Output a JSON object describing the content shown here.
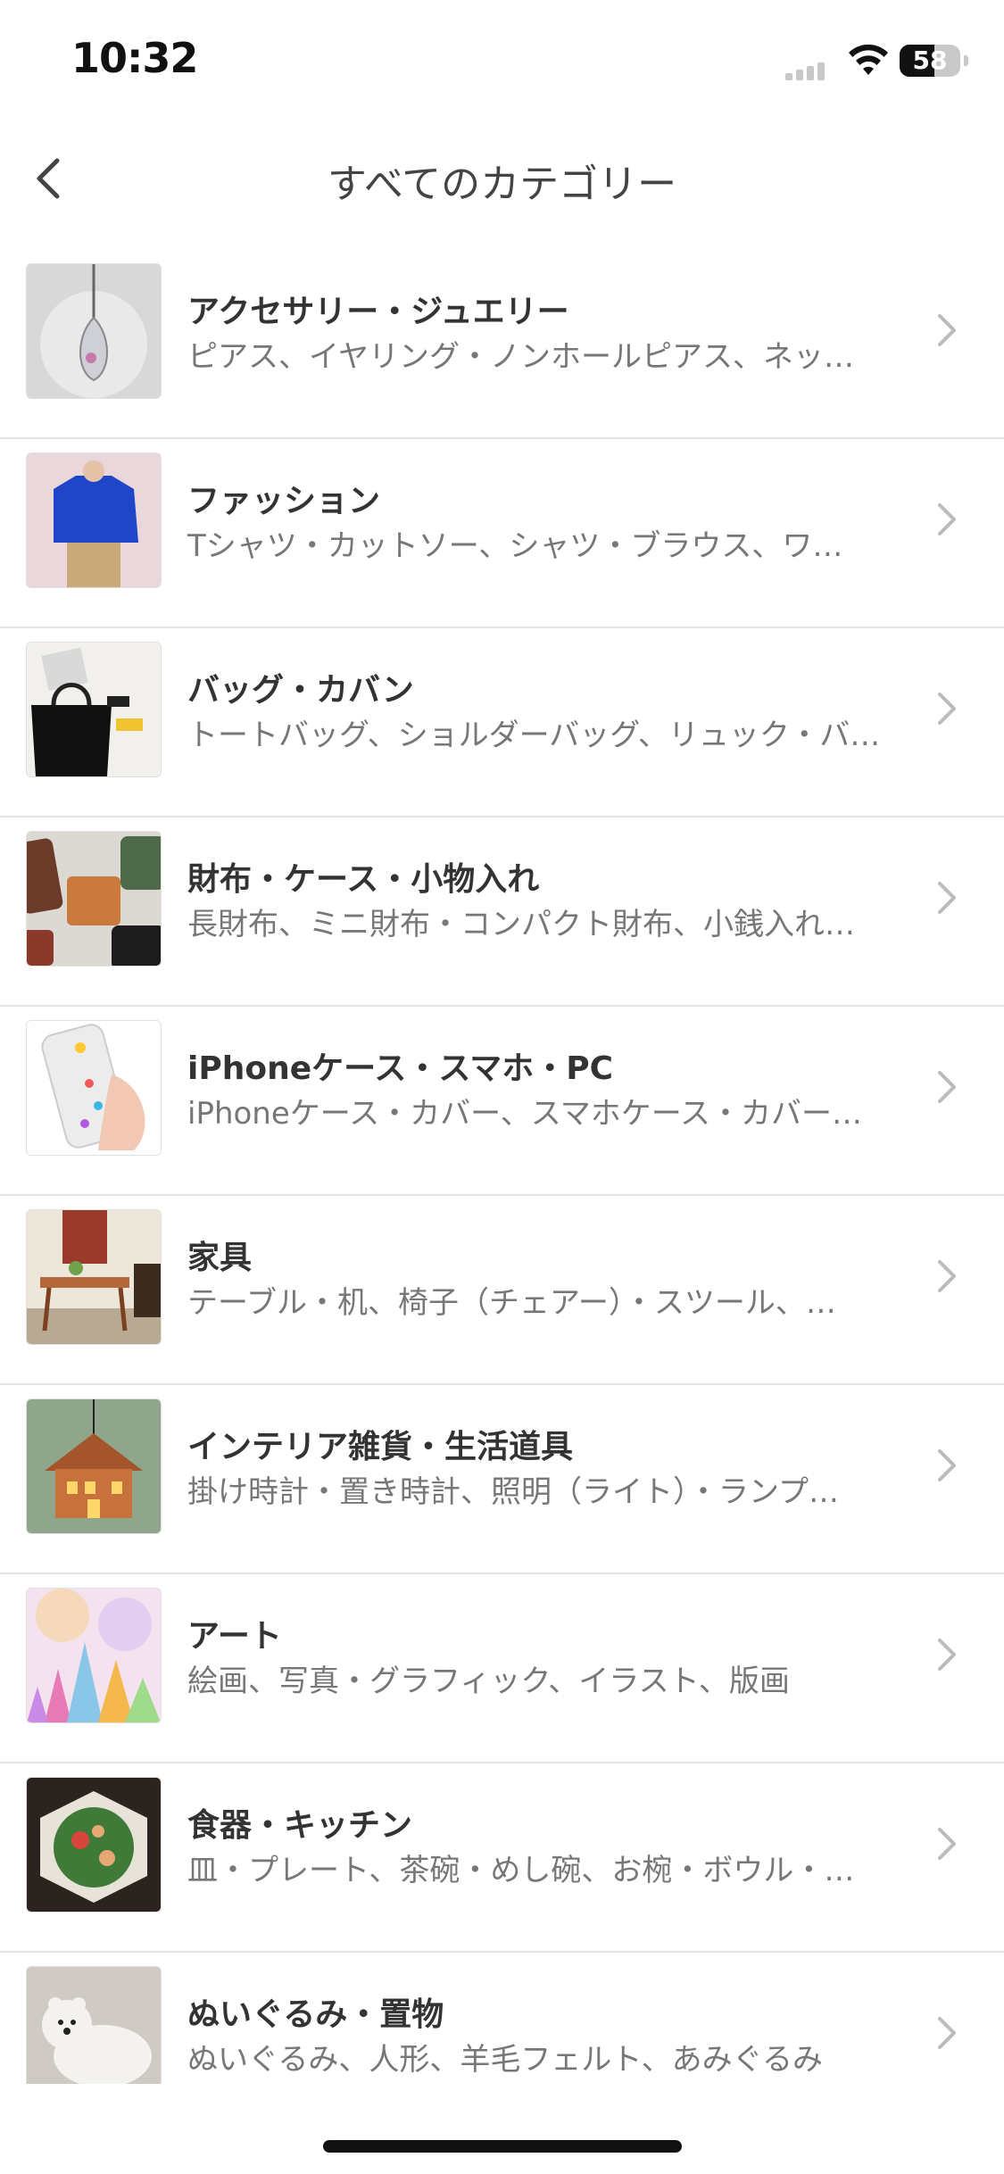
{
  "status": {
    "time": "10:32",
    "battery": "58",
    "battery_level": 0.58
  },
  "nav": {
    "title": "すべてのカテゴリー"
  },
  "categories": [
    {
      "title": "アクセサリー・ジュエリー",
      "subtitle": "ピアス、イヤリング・ノンホールピアス、ネッ…",
      "thumb": "necklace-pendant"
    },
    {
      "title": "ファッション",
      "subtitle": "Tシャツ・カットソー、シャツ・ブラウス、ワ…",
      "thumb": "blue-blouse"
    },
    {
      "title": "バッグ・カバン",
      "subtitle": "トートバッグ、ショルダーバッグ、リュック・バ…",
      "thumb": "black-tote-bag"
    },
    {
      "title": "財布・ケース・小物入れ",
      "subtitle": "長財布、ミニ財布・コンパクト財布、小銭入れ…",
      "thumb": "leather-wallets"
    },
    {
      "title": "iPhoneケース・スマホ・PC",
      "subtitle": "iPhoneケース・カバー、スマホケース・カバー…",
      "thumb": "phone-case"
    },
    {
      "title": "家具",
      "subtitle": "テーブル・机、椅子（チェアー）・スツール、…",
      "thumb": "wooden-table"
    },
    {
      "title": "インテリア雑貨・生活道具",
      "subtitle": "掛け時計・置き時計、照明（ライト）・ランプ…",
      "thumb": "house-lamp"
    },
    {
      "title": "アート",
      "subtitle": "絵画、写真・グラフィック、イラスト、版画",
      "thumb": "colorful-art"
    },
    {
      "title": "食器・キッチン",
      "subtitle": "皿・プレート、茶碗・めし碗、お椀・ボウル・…",
      "thumb": "dish-salad"
    },
    {
      "title": "ぬいぐるみ・置物",
      "subtitle": "ぬいぐるみ、人形、羊毛フェルト、あみぐるみ",
      "thumb": "polar-bear-figure"
    }
  ]
}
